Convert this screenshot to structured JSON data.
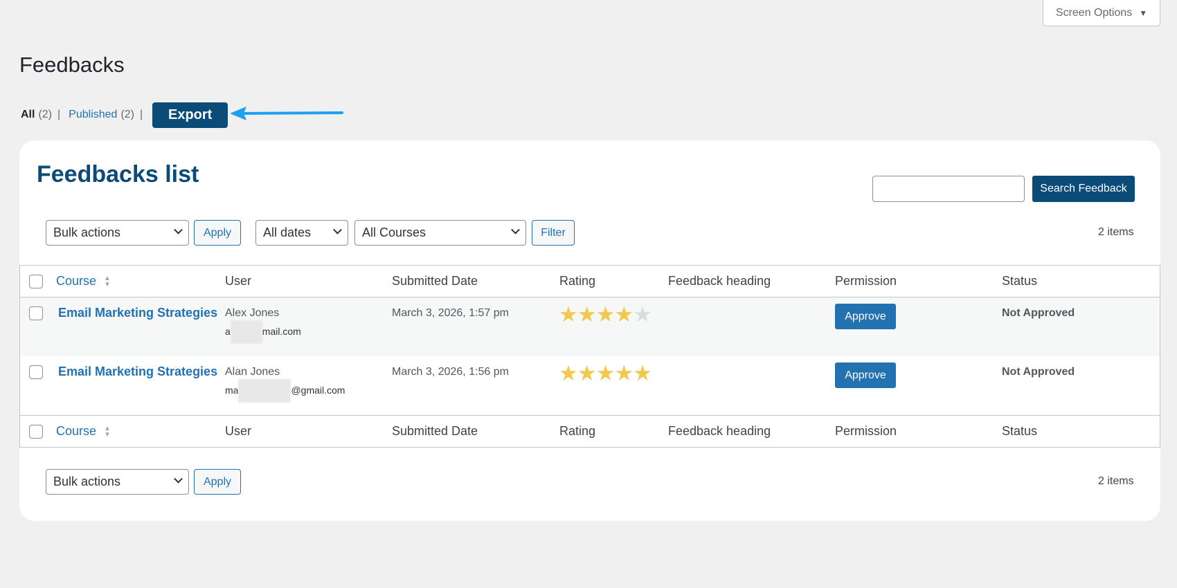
{
  "screen_options": {
    "label": "Screen Options",
    "icon": "triangle-down-icon"
  },
  "page": {
    "title": "Feedbacks"
  },
  "views": {
    "all_label": "All",
    "all_count": "(2)",
    "published_label": "Published",
    "published_count": "(2)",
    "separator": "|",
    "export_label": "Export"
  },
  "card": {
    "title": "Feedbacks list",
    "search_button": "Search Feedback",
    "search_value": ""
  },
  "filters": {
    "bulk_actions": "Bulk actions",
    "apply": "Apply",
    "dates": "All dates",
    "courses": "All Courses",
    "filter": "Filter",
    "items_count": "2 items"
  },
  "columns": {
    "course": "Course",
    "user": "User",
    "submitted_date": "Submitted Date",
    "rating": "Rating",
    "feedback_heading": "Feedback heading",
    "permission": "Permission",
    "status": "Status"
  },
  "rows": [
    {
      "course": "Email Marketing Strategies",
      "user_name": "Alex Jones",
      "email_prefix": "a",
      "email_suffix": "mail.com",
      "submitted": "March 3, 2026, 1:57 pm",
      "rating": 4,
      "feedback_heading": "",
      "permission": "Approve",
      "status": "Not Approved"
    },
    {
      "course": "Email Marketing Strategies",
      "user_name": "Alan Jones",
      "email_prefix": "ma",
      "email_suffix": "@gmail.com",
      "submitted": "March 3, 2026, 1:56 pm",
      "rating": 5,
      "feedback_heading": "",
      "permission": "Approve",
      "status": "Not Approved"
    }
  ],
  "colors": {
    "primary": "#0a4b78",
    "link": "#2271b1",
    "star": "#f2c94c",
    "arrow": "#1ea0f0"
  }
}
